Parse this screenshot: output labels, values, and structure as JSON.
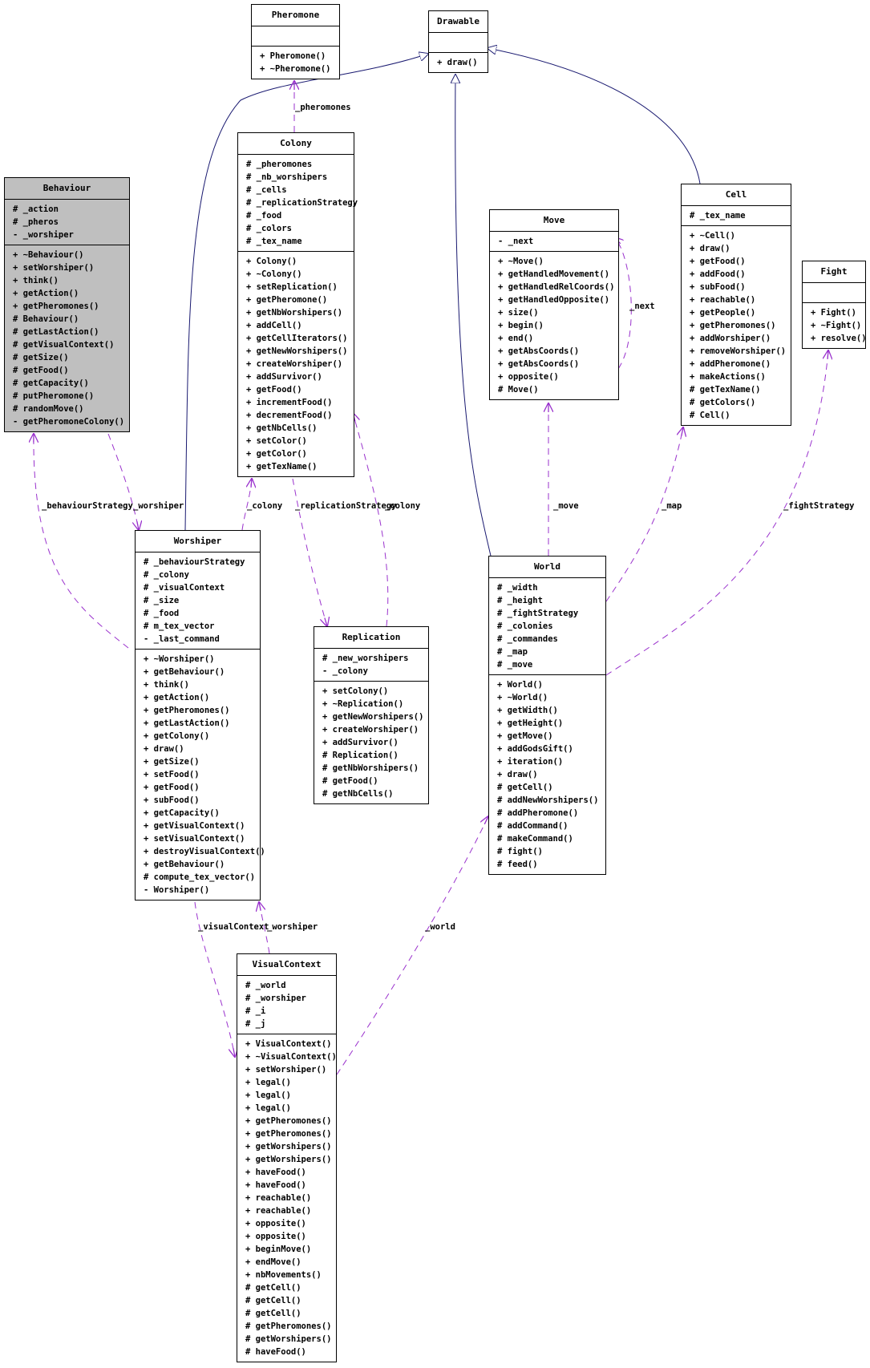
{
  "classes": [
    {
      "id": "pheromone",
      "name": "Pheromone",
      "attributes": [],
      "methods": [
        "+ Pheromone()",
        "+ ~Pheromone()"
      ]
    },
    {
      "id": "drawable",
      "name": "Drawable",
      "attributes": [],
      "methods": [
        "+ draw()"
      ]
    },
    {
      "id": "behaviour",
      "name": "Behaviour",
      "highlighted": true,
      "attributes": [
        "# _action",
        "# _pheros",
        "- _worshiper"
      ],
      "methods": [
        "+ ~Behaviour()",
        "+ setWorshiper()",
        "+ think()",
        "+ getAction()",
        "+ getPheromones()",
        "# Behaviour()",
        "# getLastAction()",
        "# getVisualContext()",
        "# getSize()",
        "# getFood()",
        "# getCapacity()",
        "# putPheromone()",
        "# randomMove()",
        "- getPheromoneColony()"
      ]
    },
    {
      "id": "colony",
      "name": "Colony",
      "attributes": [
        "# _pheromones",
        "# _nb_worshipers",
        "# _cells",
        "# _replicationStrategy",
        "# _food",
        "# _colors",
        "# _tex_name"
      ],
      "methods": [
        "+ Colony()",
        "+ ~Colony()",
        "+ setReplication()",
        "+ getPheromone()",
        "+ getNbWorshipers()",
        "+ addCell()",
        "+ getCellIterators()",
        "+ getNewWorshipers()",
        "+ createWorshiper()",
        "+ addSurvivor()",
        "+ getFood()",
        "+ incrementFood()",
        "+ decrementFood()",
        "+ getNbCells()",
        "+ setColor()",
        "+ getColor()",
        "+ getTexName()"
      ]
    },
    {
      "id": "move",
      "name": "Move",
      "attributes": [
        "- _next"
      ],
      "methods": [
        "+ ~Move()",
        "+ getHandledMovement()",
        "+ getHandledRelCoords()",
        "+ getHandledOpposite()",
        "+ size()",
        "+ begin()",
        "+ end()",
        "+ getAbsCoords()",
        "+ getAbsCoords()",
        "+ opposite()",
        "# Move()"
      ]
    },
    {
      "id": "cell",
      "name": "Cell",
      "attributes": [
        "# _tex_name"
      ],
      "methods": [
        "+ ~Cell()",
        "+ draw()",
        "+ getFood()",
        "+ addFood()",
        "+ subFood()",
        "+ reachable()",
        "+ getPeople()",
        "+ getPheromones()",
        "+ addWorshiper()",
        "+ removeWorshiper()",
        "+ addPheromone()",
        "+ makeActions()",
        "# getTexName()",
        "# getColors()",
        "# Cell()"
      ]
    },
    {
      "id": "fight",
      "name": "Fight",
      "attributes": [],
      "methods": [
        "+ Fight()",
        "+ ~Fight()",
        "+ resolve()"
      ]
    },
    {
      "id": "worshiper",
      "name": "Worshiper",
      "attributes": [
        "# _behaviourStrategy",
        "# _colony",
        "# _visualContext",
        "# _size",
        "# _food",
        "# m_tex_vector",
        "- _last_command"
      ],
      "methods": [
        "+ ~Worshiper()",
        "+ getBehaviour()",
        "+ think()",
        "+ getAction()",
        "+ getPheromones()",
        "+ getLastAction()",
        "+ getColony()",
        "+ draw()",
        "+ getSize()",
        "+ setFood()",
        "+ getFood()",
        "+ subFood()",
        "+ getCapacity()",
        "+ getVisualContext()",
        "+ setVisualContext()",
        "+ destroyVisualContext()",
        "+ getBehaviour()",
        "# compute_tex_vector()",
        "- Worshiper()"
      ]
    },
    {
      "id": "replication",
      "name": "Replication",
      "attributes": [
        "# _new_worshipers",
        "- _colony"
      ],
      "methods": [
        "+ setColony()",
        "+ ~Replication()",
        "+ getNewWorshipers()",
        "+ createWorshiper()",
        "+ addSurvivor()",
        "# Replication()",
        "# getNbWorshipers()",
        "# getFood()",
        "# getNbCells()"
      ]
    },
    {
      "id": "world",
      "name": "World",
      "attributes": [
        "# _width",
        "# _height",
        "# _fightStrategy",
        "# _colonies",
        "# _commandes",
        "# _map",
        "# _move"
      ],
      "methods": [
        "+ World()",
        "+ ~World()",
        "+ getWidth()",
        "+ getHeight()",
        "+ getMove()",
        "+ addGodsGift()",
        "+ iteration()",
        "+ draw()",
        "# getCell()",
        "# addNewWorshipers()",
        "# addPheromone()",
        "# addCommand()",
        "# makeCommand()",
        "# fight()",
        "# feed()"
      ]
    },
    {
      "id": "visualcontext",
      "name": "VisualContext",
      "attributes": [
        "# _world",
        "# _worshiper",
        "# _i",
        "# _j"
      ],
      "methods": [
        "+ VisualContext()",
        "+ ~VisualContext()",
        "+ setWorshiper()",
        "+ legal()",
        "+ legal()",
        "+ legal()",
        "+ getPheromones()",
        "+ getPheromones()",
        "+ getWorshipers()",
        "+ getWorshipers()",
        "+ haveFood()",
        "+ haveFood()",
        "+ reachable()",
        "+ reachable()",
        "+ opposite()",
        "+ opposite()",
        "+ beginMove()",
        "+ endMove()",
        "+ nbMovements()",
        "# getCell()",
        "# getCell()",
        "# getCell()",
        "# getPheromones()",
        "# getWorshipers()",
        "# haveFood()"
      ]
    }
  ],
  "relations": [
    {
      "type": "inheritance",
      "from": "worshiper",
      "to": "drawable"
    },
    {
      "type": "inheritance",
      "from": "world",
      "to": "drawable"
    },
    {
      "type": "inheritance",
      "from": "cell",
      "to": "drawable"
    },
    {
      "type": "usage",
      "from": "colony",
      "to": "pheromone",
      "label": "_pheromones"
    },
    {
      "type": "usage",
      "from": "worshiper",
      "to": "behaviour",
      "label": "_behaviourStrategy"
    },
    {
      "type": "usage",
      "from": "behaviour",
      "to": "worshiper",
      "label": "_worshiper"
    },
    {
      "type": "usage",
      "from": "worshiper",
      "to": "colony",
      "label": "_colony"
    },
    {
      "type": "usage",
      "from": "colony",
      "to": "replication",
      "label": "_replicationStrategy"
    },
    {
      "type": "usage",
      "from": "replication",
      "to": "colony",
      "label": "_colony"
    },
    {
      "type": "usage",
      "from": "move",
      "to": "move",
      "label": "_next"
    },
    {
      "type": "usage",
      "from": "world",
      "to": "move",
      "label": "_move"
    },
    {
      "type": "usage",
      "from": "world",
      "to": "cell",
      "label": "_map"
    },
    {
      "type": "usage",
      "from": "world",
      "to": "fight",
      "label": "_fightStrategy"
    },
    {
      "type": "usage",
      "from": "worshiper",
      "to": "visualcontext",
      "label": "_visualContext"
    },
    {
      "type": "usage",
      "from": "visualcontext",
      "to": "worshiper",
      "label": "_worshiper"
    },
    {
      "type": "usage",
      "from": "visualcontext",
      "to": "world",
      "label": "_world"
    }
  ],
  "colors": {
    "inheritance": "#191970",
    "usage": "#9a32cd",
    "highlight": "#bfbfbf"
  }
}
